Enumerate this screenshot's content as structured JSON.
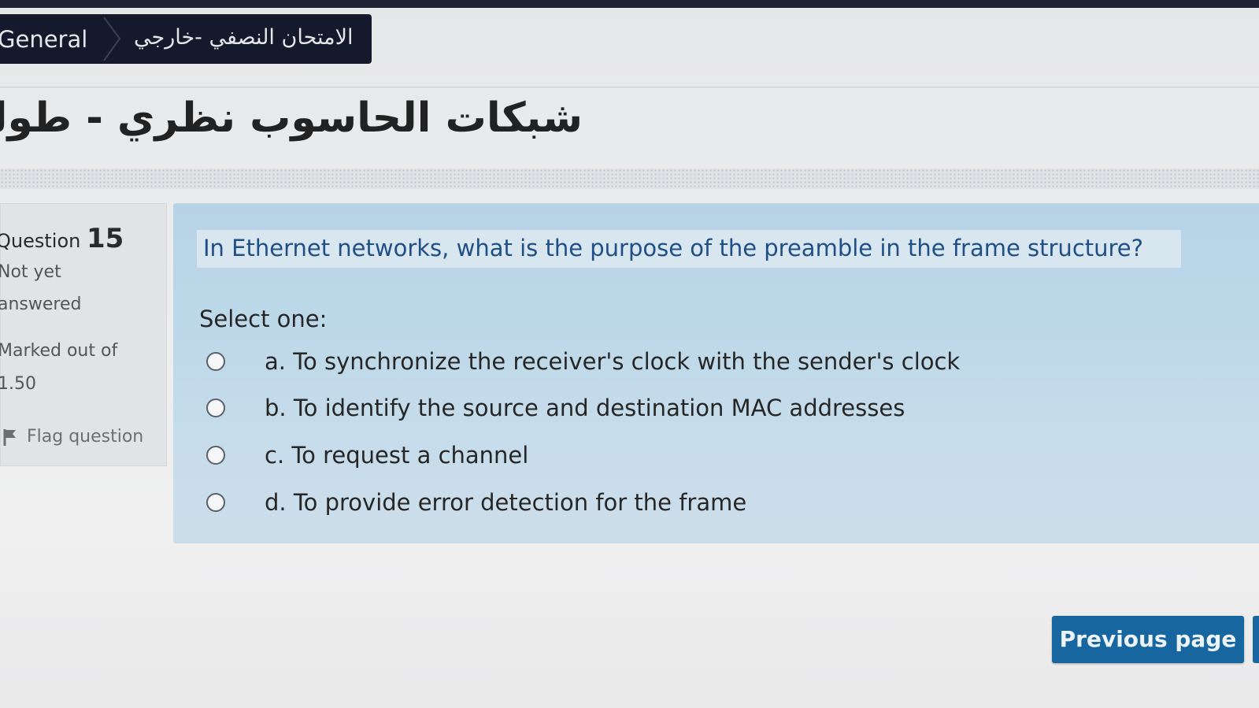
{
  "breadcrumb": {
    "general": "General",
    "exam": "الامتحان النصفي -خارجي"
  },
  "course": {
    "title": "شبكات الحاسوب نظري - طولكر"
  },
  "info": {
    "question_word": "Question",
    "question_number": "15",
    "status_line1": "Not yet",
    "status_line2": "answered",
    "marked_line1": "Marked out of",
    "marked_line2": "1.50",
    "flag_label": "Flag question"
  },
  "question": {
    "text": "In Ethernet networks, what is the purpose of the preamble in the frame structure?",
    "select_one": "Select one:",
    "options": [
      {
        "label": "a. To synchronize the receiver's clock with the sender's clock"
      },
      {
        "label": "b. To identify the source and destination MAC addresses"
      },
      {
        "label": "c. To request a channel"
      },
      {
        "label": "d. To provide error detection for the frame"
      }
    ]
  },
  "nav": {
    "previous_label": "Previous page"
  },
  "colors": {
    "breadcrumb_bg": "#14192b",
    "question_text": "#1f4f86",
    "panel_bg": "#bdd8e9",
    "button_bg": "#17669f"
  }
}
